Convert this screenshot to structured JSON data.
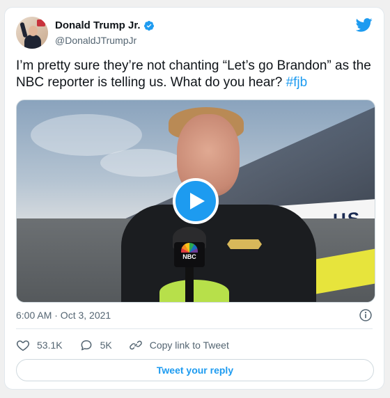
{
  "author": {
    "name": "Donald Trump Jr.",
    "handle": "@DonaldJTrumpJr",
    "verified": true
  },
  "tweet": {
    "text": "I’m pretty sure they’re not chanting “Let’s go Brandon” as the NBC reporter is telling us. What do you hear? ",
    "hashtag": "#fjb",
    "timestamp": "6:00 AM · Oct 3, 2021"
  },
  "media": {
    "type": "video",
    "wall_text": "US",
    "mic_flag_text": "NBC"
  },
  "actions": {
    "likes": "53.1K",
    "replies": "5K",
    "copy_link_label": "Copy link to Tweet"
  },
  "reply_button_label": "Tweet your reply",
  "colors": {
    "accent": "#1d9bf0",
    "text_primary": "#0f1419",
    "text_secondary": "#536471"
  },
  "icons": [
    "verified-badge-icon",
    "twitter-bird-icon",
    "play-icon",
    "info-icon",
    "heart-icon",
    "reply-bubble-icon",
    "link-icon"
  ]
}
